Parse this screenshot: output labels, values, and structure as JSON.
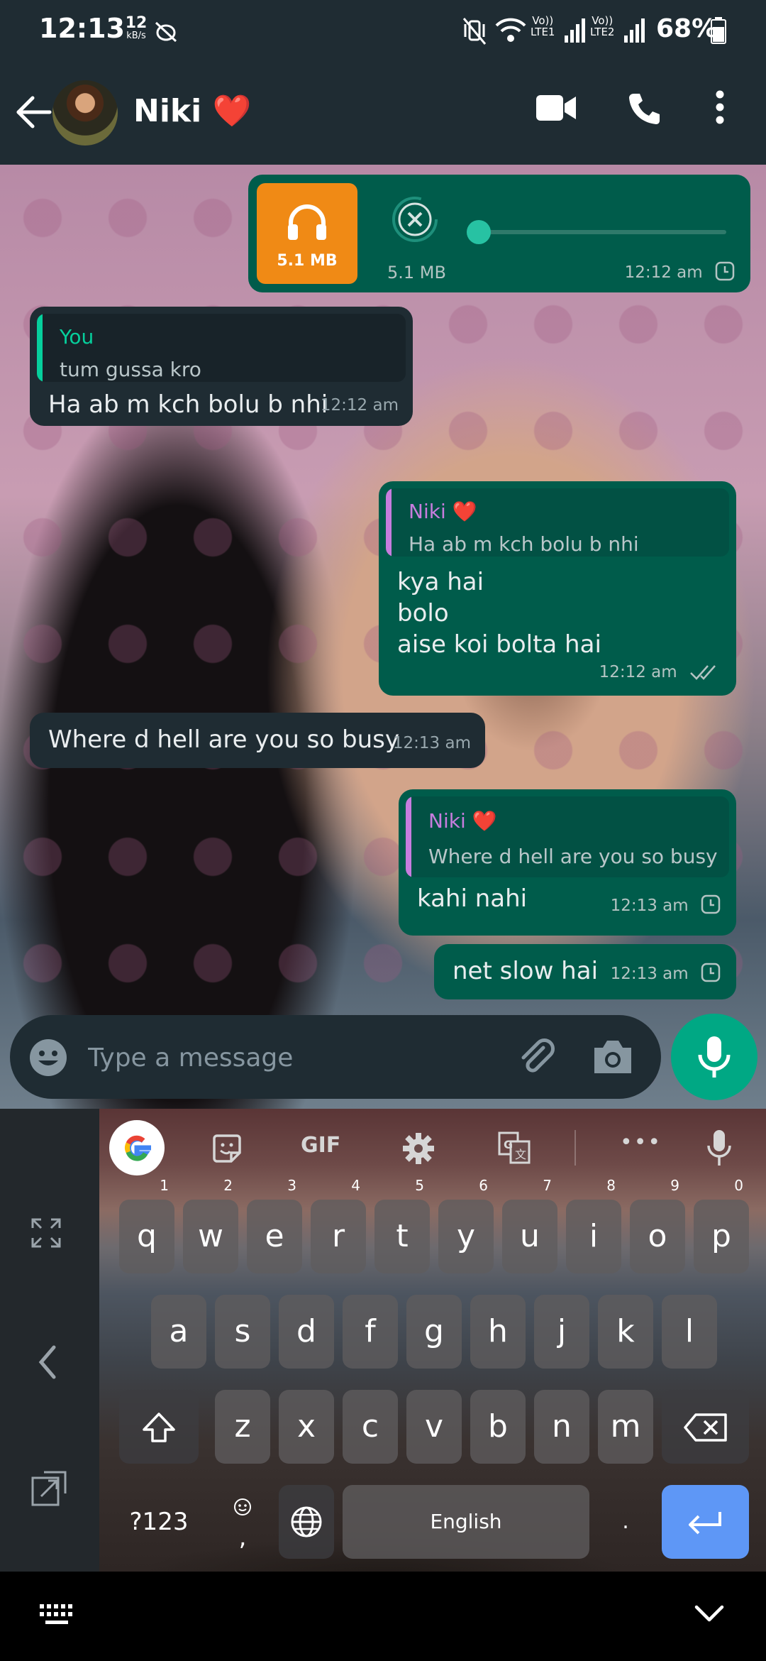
{
  "status_bar": {
    "time": "12:13",
    "net_speed_value": "12",
    "net_speed_unit": "kB/s",
    "sim1_label": "Vo))",
    "sim1_sub": "LTE1",
    "sim2_label": "Vo))",
    "sim2_sub": "LTE2",
    "battery": "68%"
  },
  "header": {
    "contact_name": "Niki",
    "contact_emoji": "❤️"
  },
  "messages": [
    {
      "direction": "out",
      "type": "audio",
      "thumb_size": "5.1 MB",
      "size": "5.1 MB",
      "time": "12:12 am",
      "status": "pending-clock-icon"
    },
    {
      "direction": "in",
      "quote_author": "You",
      "quote_text": "tum gussa kro",
      "text": "Ha ab m kch bolu b nhi",
      "time": "12:12 am"
    },
    {
      "direction": "out",
      "quote_author": "Niki ❤️",
      "quote_text": "Ha ab m kch bolu b nhi",
      "lines": [
        "kya hai",
        "bolo",
        "aise koi bolta hai"
      ],
      "time": "12:12 am",
      "status": "double-tick-icon"
    },
    {
      "direction": "in",
      "text": "Where d hell are you so busy",
      "time": "12:13 am"
    },
    {
      "direction": "out",
      "quote_author": "Niki ❤️",
      "quote_text": "Where d hell are you so busy",
      "text": "kahi nahi",
      "time": "12:13 am",
      "status": "pending-clock-icon"
    },
    {
      "direction": "out",
      "text": "net slow hai",
      "time": "12:13 am",
      "status": "pending-clock-icon"
    }
  ],
  "composer": {
    "placeholder": "Type a message"
  },
  "keyboard": {
    "toolbar_gif": "GIF",
    "toolbar_more": "•••",
    "row1": [
      {
        "k": "q",
        "h": "1"
      },
      {
        "k": "w",
        "h": "2"
      },
      {
        "k": "e",
        "h": "3"
      },
      {
        "k": "r",
        "h": "4"
      },
      {
        "k": "t",
        "h": "5"
      },
      {
        "k": "y",
        "h": "6"
      },
      {
        "k": "u",
        "h": "7"
      },
      {
        "k": "i",
        "h": "8"
      },
      {
        "k": "o",
        "h": "9"
      },
      {
        "k": "p",
        "h": "0"
      }
    ],
    "row2": [
      "a",
      "s",
      "d",
      "f",
      "g",
      "h",
      "j",
      "k",
      "l"
    ],
    "row3": [
      "z",
      "x",
      "c",
      "v",
      "b",
      "n",
      "m"
    ],
    "symbols_key": "?123",
    "emoji_comma_key": ",",
    "space_label": "English",
    "period_key": "."
  },
  "colors": {
    "header_bg": "#1f2c33",
    "incoming_bubble": "#1f2c33",
    "outgoing_bubble": "#005c4b",
    "accent_green": "#00a884",
    "quote_you": "#06cf9c",
    "quote_niki": "#c77dde",
    "audio_thumb": "#f08a15",
    "enter_key": "#5e97f6"
  }
}
